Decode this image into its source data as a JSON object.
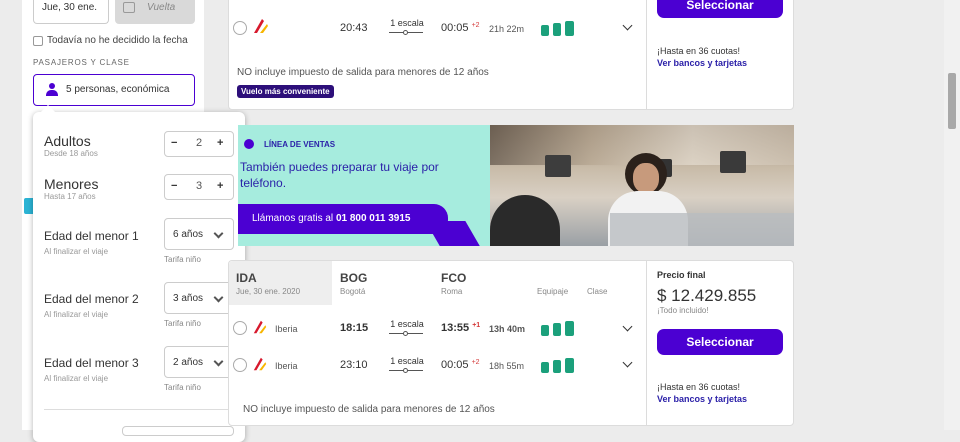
{
  "sidebar": {
    "date_value": "Jue, 30 ene.",
    "return_placeholder": "Vuelta",
    "undecided_label": "Todavía no he decidido la fecha",
    "pax_section": "PASAJEROS Y CLASE",
    "pax_value": "5 personas, económica"
  },
  "pax_popup": {
    "adults_label": "Adultos",
    "adults_sub": "Desde 18 años",
    "adults_count": "2",
    "minors_label": "Menores",
    "minors_sub": "Hasta 17 años",
    "minors_count": "3",
    "minus": "−",
    "plus": "+",
    "ages": [
      {
        "label": "Edad del menor 1",
        "sub": "Al finalizar el viaje",
        "value": "6 años",
        "fare": "Tarifa niño"
      },
      {
        "label": "Edad del menor 2",
        "sub": "Al finalizar el viaje",
        "value": "3 años",
        "fare": "Tarifa niño"
      },
      {
        "label": "Edad del menor 3",
        "sub": "Al finalizar el viaje",
        "value": "2 años",
        "fare": "Tarifa niño"
      }
    ]
  },
  "card1": {
    "dep": "20:43",
    "stops": "1 escala",
    "arr": "00:05",
    "plus": "+2",
    "dur": "21h 22m",
    "note": "NO incluye impuesto de salida para menores de 12 años",
    "badge": "Vuelo más conveniente",
    "select": "Seleccionar",
    "installments": "¡Hasta en 36 cuotas!",
    "banks": "Ver bancos y tarjetas"
  },
  "banner": {
    "tag": "LÍNEA DE VENTAS",
    "text": "También puedes preparar tu viaje por teléfono.",
    "cta_prefix": "Llámanos gratis al ",
    "cta_phone": "01 800 011 3915"
  },
  "card2": {
    "ida": "IDA",
    "date": "Jue, 30 ene. 2020",
    "from_code": "BOG",
    "from_city": "Bogotá",
    "to_code": "FCO",
    "to_city": "Roma",
    "col_bag": "Equipaje",
    "col_class": "Clase",
    "price_label": "Precio final",
    "price": "$ 12.429.855",
    "price_sub": "¡Todo incluido!",
    "flights": [
      {
        "airline": "Iberia",
        "dep": "18:15",
        "stops": "1 escala",
        "arr": "13:55",
        "plus": "+1",
        "dur": "13h 40m"
      },
      {
        "airline": "Iberia",
        "dep": "23:10",
        "stops": "1 escala",
        "arr": "00:05",
        "plus": "+2",
        "dur": "18h 55m"
      }
    ],
    "select": "Seleccionar",
    "installments": "¡Hasta en 36 cuotas!",
    "banks": "Ver bancos y tarjetas",
    "note": "NO incluye impuesto de salida para menores de 12 años"
  },
  "colors": {
    "accent": "#4b00d2",
    "teal": "#1ba07b",
    "banner_bg": "#a6ecde",
    "iberia_red": "#d7192d"
  }
}
